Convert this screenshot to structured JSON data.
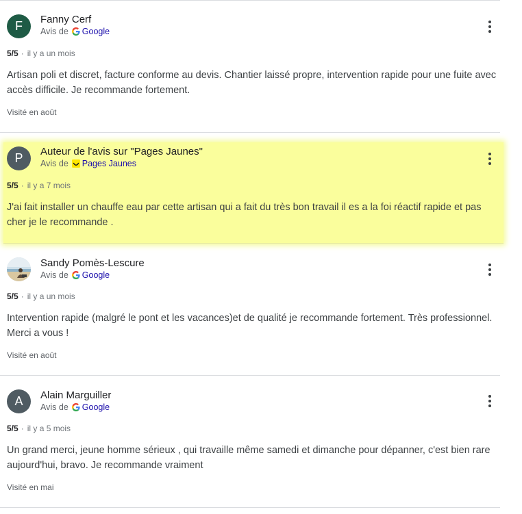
{
  "reviews": [
    {
      "author": "Fanny Cerf",
      "avatar_letter": "F",
      "avatar_color": "#1e5b45",
      "source_prefix": "Avis de",
      "source_name": "Google",
      "source_icon": "google-g-icon",
      "rating": "5/5",
      "separator": "·",
      "ago": "il y a un mois",
      "text": "Artisan poli et discret, facture conforme au devis. Chantier laissé propre, intervention rapide pour une fuite avec accès difficile. Je recommande fortement.",
      "visited": "Visité en août",
      "highlighted": false
    },
    {
      "author": "Auteur de l'avis sur \"Pages Jaunes\"",
      "avatar_letter": "P",
      "avatar_color": "#4f5b62",
      "source_prefix": "Avis de",
      "source_name": "Pages Jaunes",
      "source_icon": "pages-jaunes-smiley-icon",
      "rating": "5/5",
      "separator": "·",
      "ago": "il y a 7 mois",
      "text": "J'ai fait installer un chauffe eau par cette artisan qui a fait du très bon travail il es a la foi réactif rapide et pas cher je le recommande .",
      "visited": "",
      "highlighted": true,
      "highlight_color": "#fafe9c"
    },
    {
      "author": "Sandy Pomès-Lescure",
      "avatar_letter": "",
      "avatar_color": "#c9d3db",
      "source_prefix": "Avis de",
      "source_name": "Google",
      "source_icon": "google-g-icon",
      "rating": "5/5",
      "separator": "·",
      "ago": "il y a un mois",
      "text": "Intervention rapide (malgré le pont et les vacances)et de qualité je recommande fortement. Très professionnel. Merci a vous !",
      "visited": "Visité en août",
      "highlighted": false
    },
    {
      "author": "Alain Marguiller",
      "avatar_letter": "A",
      "avatar_color": "#4f5b62",
      "source_prefix": "Avis de",
      "source_name": "Google",
      "source_icon": "google-g-icon",
      "rating": "5/5",
      "separator": "·",
      "ago": "il y a 5 mois",
      "text": "Un grand merci, jeune homme sérieux , qui travaille même samedi et dimanche pour dépanner, c'est bien rare aujourd'hui, bravo. Je recommande vraiment",
      "visited": "Visité en mai",
      "highlighted": false
    }
  ],
  "more_icon": "more-vert-icon"
}
